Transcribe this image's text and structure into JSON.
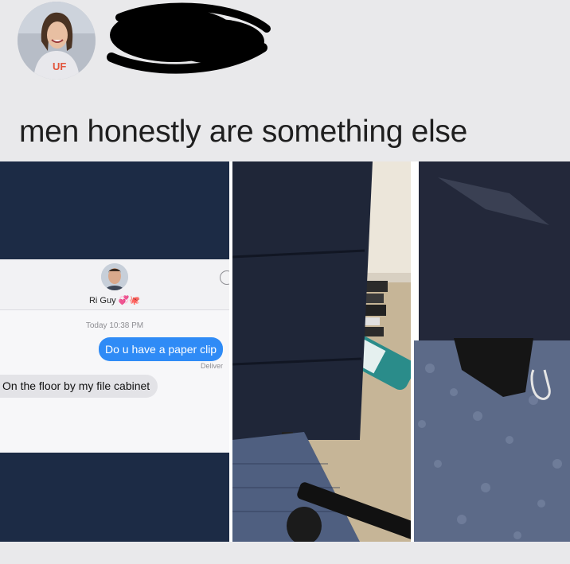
{
  "post": {
    "caption": "men honestly are something else",
    "avatar_icon": "profile-photo",
    "author_name_redacted": true
  },
  "screenshot": {
    "contact_name": "Ri Guy 💞🐙",
    "timestamp": "Today 10:38 PM",
    "outgoing_message": "Do u have a paper clip",
    "delivered_status": "Deliver",
    "incoming_message": "On the floor by my file cabinet",
    "bubble_out_color": "#2f8bf6",
    "bubble_in_color": "#e3e3e7"
  },
  "photos": [
    {
      "subject": "file cabinet and carpet"
    },
    {
      "subject": "paper clip under cabinet"
    }
  ]
}
